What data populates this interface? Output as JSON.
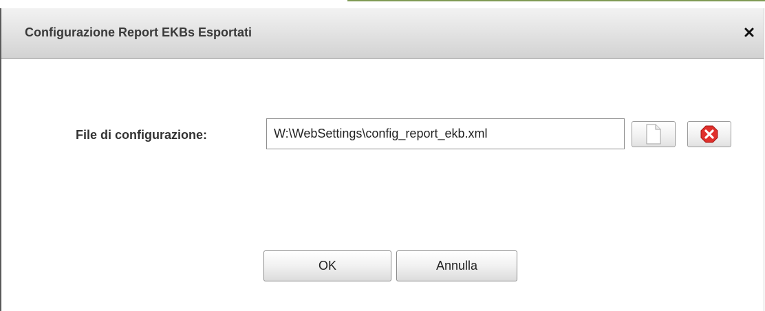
{
  "dialog": {
    "title": "Configurazione Report EKBs Esportati",
    "close_icon": "close-icon"
  },
  "form": {
    "config_label": "File di configurazione:",
    "config_value": "W:\\WebSettings\\config_report_ekb.xml",
    "browse_icon": "document-icon",
    "clear_icon": "remove-red-icon"
  },
  "actions": {
    "ok_label": "OK",
    "cancel_label": "Annulla"
  },
  "colors": {
    "remove_icon": "#e0302c",
    "title_text": "#3a3a3a"
  }
}
